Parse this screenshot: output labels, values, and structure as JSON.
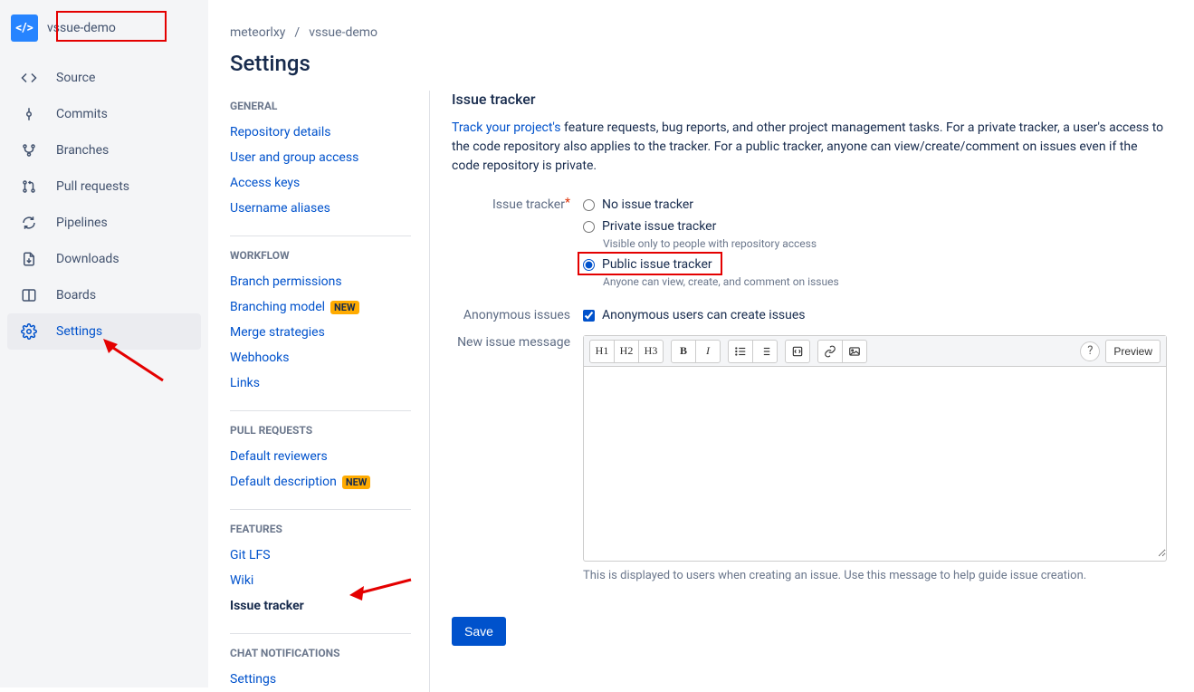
{
  "project": {
    "name": "vssue-demo"
  },
  "breadcrumb": {
    "owner": "meteorlxy",
    "repo": "vssue-demo",
    "sep": "/"
  },
  "page": {
    "title": "Settings"
  },
  "sidebar": {
    "items": [
      {
        "label": "Source",
        "icon": "code-icon"
      },
      {
        "label": "Commits",
        "icon": "commit-icon"
      },
      {
        "label": "Branches",
        "icon": "branch-icon"
      },
      {
        "label": "Pull requests",
        "icon": "pullrequest-icon"
      },
      {
        "label": "Pipelines",
        "icon": "pipeline-icon"
      },
      {
        "label": "Downloads",
        "icon": "download-icon"
      },
      {
        "label": "Boards",
        "icon": "board-icon"
      },
      {
        "label": "Settings",
        "icon": "gear-icon",
        "active": true
      }
    ]
  },
  "settings_nav": {
    "general": {
      "head": "GENERAL",
      "items": [
        "Repository details",
        "User and group access",
        "Access keys",
        "Username aliases"
      ]
    },
    "workflow": {
      "head": "WORKFLOW",
      "items": [
        "Branch permissions",
        "Branching model",
        "Merge strategies",
        "Webhooks",
        "Links"
      ],
      "new_label": "NEW",
      "new_on": 1
    },
    "pull": {
      "head": "PULL REQUESTS",
      "items": [
        "Default reviewers",
        "Default description"
      ],
      "new_label": "NEW",
      "new_on": 1
    },
    "features": {
      "head": "FEATURES",
      "items": [
        "Git LFS",
        "Wiki",
        "Issue tracker"
      ],
      "active": 2
    },
    "chat": {
      "head": "CHAT NOTIFICATIONS",
      "items": [
        "Settings"
      ]
    }
  },
  "panel": {
    "title": "Issue tracker",
    "desc_link": "Track your project's",
    "desc_rest": " feature requests, bug reports, and other project management tasks. For a private tracker, a user's access to the code repository also applies to the tracker. For a public tracker, anyone can view/create/comment on issues even if the code repository is private.",
    "form": {
      "tracker_label": "Issue tracker",
      "radios": {
        "none": {
          "label": "No issue tracker"
        },
        "private": {
          "label": "Private issue tracker",
          "hint": "Visible only to people with repository access"
        },
        "public": {
          "label": "Public issue tracker",
          "hint": "Anyone can view, create, and comment on issues",
          "checked": true
        }
      },
      "anon_label": "Anonymous issues",
      "anon_check": "Anonymous users can create issues",
      "msg_label": "New issue message",
      "toolbar": {
        "h1": "H1",
        "h2": "H2",
        "h3": "H3",
        "bold": "B",
        "italic": "I",
        "help": "?",
        "preview": "Preview"
      },
      "msg_hint": "This is displayed to users when creating an issue. Use this message to help guide issue creation.",
      "save": "Save"
    }
  }
}
